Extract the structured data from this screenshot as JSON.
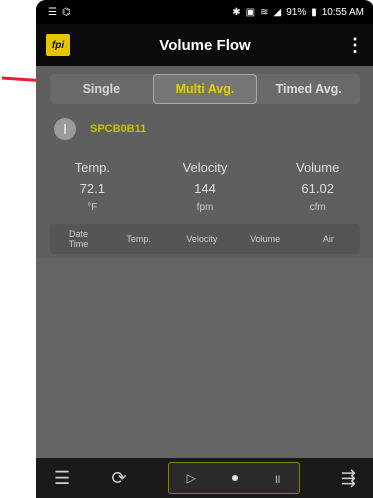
{
  "status_bar": {
    "left_icons": [
      "menu-icon",
      "cast-icon"
    ],
    "right_icons": [
      "bluetooth-icon",
      "image-icon",
      "wifi-icon",
      "signal-icon",
      "battery-icon"
    ],
    "battery": "91%",
    "time": "10:55 AM"
  },
  "app_bar": {
    "logo": "fpi",
    "title": "Volume Flow",
    "menu_glyph": "⋮"
  },
  "tabs": [
    {
      "label": "Single",
      "active": false
    },
    {
      "label": "Multi Avg.",
      "active": true
    },
    {
      "label": "Timed Avg.",
      "active": false
    }
  ],
  "probe": {
    "label": "SPCB0B11"
  },
  "readings": [
    {
      "name": "Temp.",
      "value": "72.1",
      "unit": "°F"
    },
    {
      "name": "Velocity",
      "value": "144",
      "unit": "fpm"
    },
    {
      "name": "Volume",
      "value": "61.02",
      "unit": "cfm"
    }
  ],
  "log_table": {
    "headers": [
      "Date\nTime",
      "Temp.",
      "Velocity",
      "Volume",
      "Air"
    ],
    "rows": []
  },
  "bottom_bar": {
    "left_icon": "list-icon",
    "refresh_icon": "refresh-icon",
    "controls": [
      "play-icon",
      "record-icon",
      "pause-icon"
    ],
    "right_icon": "export-icon"
  },
  "colors": {
    "accent": "#e3d000",
    "annotation_arrow": "#e8202a"
  }
}
